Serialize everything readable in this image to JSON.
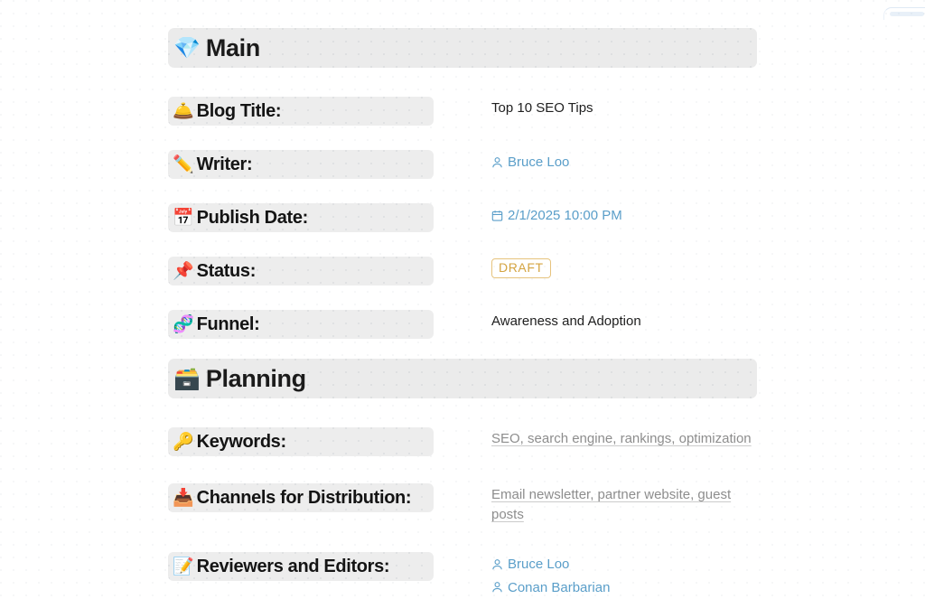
{
  "sections": [
    {
      "id": "main",
      "emoji": "💎",
      "emoji_name": "diamond-icon",
      "title": "Main"
    },
    {
      "id": "planning",
      "emoji": "🗃️",
      "emoji_name": "card-file-box-icon",
      "title": "Planning"
    }
  ],
  "fields": {
    "blog_title": {
      "emoji": "🛎️",
      "emoji_name": "bellhop-bell-icon",
      "label": "Blog Title:",
      "value": "Top 10 SEO Tips"
    },
    "writer": {
      "emoji": "✏️",
      "emoji_name": "pencil-icon",
      "label": "Writer:",
      "people": [
        {
          "icon": "person-icon",
          "name": "Bruce Loo"
        }
      ]
    },
    "publish_date": {
      "emoji": "📅",
      "emoji_name": "calendar-icon",
      "label": "Publish Date:",
      "icon": "calendar-small-icon",
      "value": "2/1/2025 10:00 PM"
    },
    "status": {
      "emoji": "📌",
      "emoji_name": "pushpin-icon",
      "label": "Status:",
      "badge": "DRAFT",
      "badge_color": "#d4a441",
      "badge_border": "#e6c37d"
    },
    "funnel": {
      "emoji": "🧬",
      "emoji_name": "dna-icon",
      "label": "Funnel:",
      "value": "Awareness and Adoption"
    },
    "keywords": {
      "emoji": "🔑",
      "emoji_name": "key-icon",
      "label": "Keywords:",
      "value": "SEO, search engine, rankings, optimization"
    },
    "channels": {
      "emoji": "📥",
      "emoji_name": "inbox-tray-icon",
      "label": "Channels for Distribution:",
      "value": "Email newsletter, partner website, guest posts"
    },
    "reviewers": {
      "emoji": "📝",
      "emoji_name": "memo-icon",
      "label": "Reviewers and Editors:",
      "people": [
        {
          "icon": "person-icon",
          "name": "Bruce Loo"
        },
        {
          "icon": "person-icon",
          "name": "Conan Barbarian"
        }
      ]
    }
  },
  "colors": {
    "link": "#5a9ec9",
    "label_pill_bg": "#ededed",
    "section_band_bg": "#ebebeb",
    "muted_text": "#8d8d8d",
    "body_text": "#202020"
  }
}
